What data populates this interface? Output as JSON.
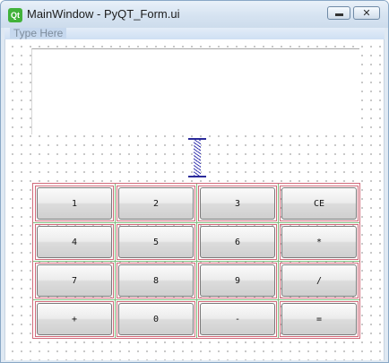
{
  "window": {
    "title": "MainWindow - PyQT_Form.ui",
    "app_icon_text": "Qt",
    "close_glyph": "✕"
  },
  "menubar": {
    "placeholder": "Type Here"
  },
  "keypad": {
    "rows": [
      [
        "1",
        "2",
        "3",
        "CE"
      ],
      [
        "4",
        "5",
        "6",
        "*"
      ],
      [
        "7",
        "8",
        "9",
        "/"
      ],
      [
        "+",
        "0",
        "-",
        "="
      ]
    ]
  },
  "icons": {
    "app": "qt-logo-icon",
    "minimize": "minimize-icon",
    "close": "close-icon",
    "spacer": "vertical-spacer-icon"
  },
  "colors": {
    "layout_outline": "#d06a7a",
    "grid_line": "#7fbf7f",
    "spacer": "#2b2b9a",
    "qt_green": "#41b23a"
  }
}
